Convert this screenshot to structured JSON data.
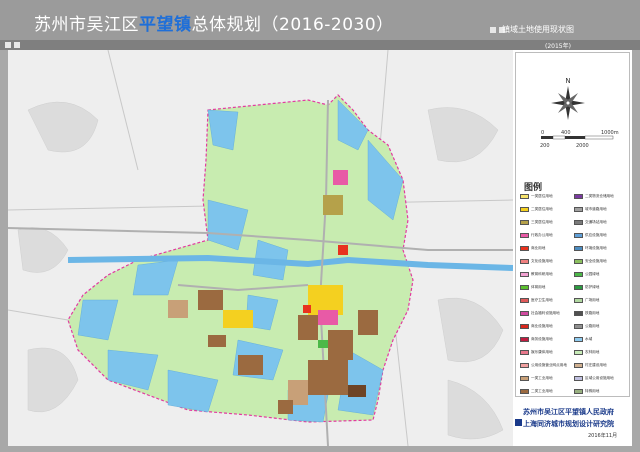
{
  "header": {
    "title_prefix": "苏州市吴江区",
    "title_highlight": "平望镇",
    "title_suffix": "总体规划（2016-2030）",
    "sheet_title": "镇域土地使用现状图",
    "sheet_year": "(2015年)"
  },
  "north_arrow": {
    "label": "N"
  },
  "scale_bar": {
    "labels": [
      "0",
      "400",
      "1000m",
      "200",
      "2000"
    ]
  },
  "legend": {
    "title": "图例",
    "items": [
      {
        "label": "一类居住用地",
        "color": "#f6e36c"
      },
      {
        "label": "二类居住用地",
        "color": "#f4d020"
      },
      {
        "label": "三类居住用地",
        "color": "#b5a14a"
      },
      {
        "label": "行政办公用地",
        "color": "#e85aa6"
      },
      {
        "label": "商业用地",
        "color": "#e8321e"
      },
      {
        "label": "文化设施用地",
        "color": "#f08080"
      },
      {
        "label": "教育科研用地",
        "color": "#f2a2d2"
      },
      {
        "label": "体育用地",
        "color": "#5bc02e"
      },
      {
        "label": "医疗卫生用地",
        "color": "#e05a5a"
      },
      {
        "label": "社会福利设施用地",
        "color": "#d04aa0"
      },
      {
        "label": "商业设施用地",
        "color": "#d8281e"
      },
      {
        "label": "商务设施用地",
        "color": "#c01c40"
      },
      {
        "label": "娱乐康体用地",
        "color": "#e8788c"
      },
      {
        "label": "公用设施营业网点用地",
        "color": "#f0a0a0"
      },
      {
        "label": "一类工业用地",
        "color": "#c8a078"
      },
      {
        "label": "二类工业用地",
        "color": "#9b6a40"
      },
      {
        "label": "三类工业用地",
        "color": "#6e4425"
      },
      {
        "label": "一类物流仓储用地",
        "color": "#a060c0"
      },
      {
        "label": "二类物流仓储用地",
        "color": "#7a3aa0"
      },
      {
        "label": "城市道路用地",
        "color": "#a0a0a0"
      },
      {
        "label": "交通场站用地",
        "color": "#7a7a7a"
      },
      {
        "label": "供应设施用地",
        "color": "#60a0d8"
      },
      {
        "label": "环境设施用地",
        "color": "#4c8cc0"
      },
      {
        "label": "安全设施用地",
        "color": "#8cc060"
      },
      {
        "label": "公园绿地",
        "color": "#4cb848"
      },
      {
        "label": "防护绿地",
        "color": "#2c9a40"
      },
      {
        "label": "广场用地",
        "color": "#b0d8a0"
      },
      {
        "label": "铁路用地",
        "color": "#505050"
      },
      {
        "label": "公路用地",
        "color": "#909090"
      },
      {
        "label": "水域",
        "color": "#8ecbf0"
      },
      {
        "label": "农林用地",
        "color": "#c8ecb8"
      },
      {
        "label": "村庄建设用地",
        "color": "#d0b090"
      },
      {
        "label": "区域公用设施用地",
        "color": "#c0c0e0"
      },
      {
        "label": "特殊用地",
        "color": "#98b080"
      },
      {
        "label": "采矿用地",
        "color": "#b09060"
      },
      {
        "label": "镇域界线",
        "color": "#ffffff"
      }
    ]
  },
  "title_block": {
    "line1": "苏州市吴江区平望镇人民政府",
    "line2": "上海同济城市规划设计研究院",
    "date": "2016年11月"
  }
}
